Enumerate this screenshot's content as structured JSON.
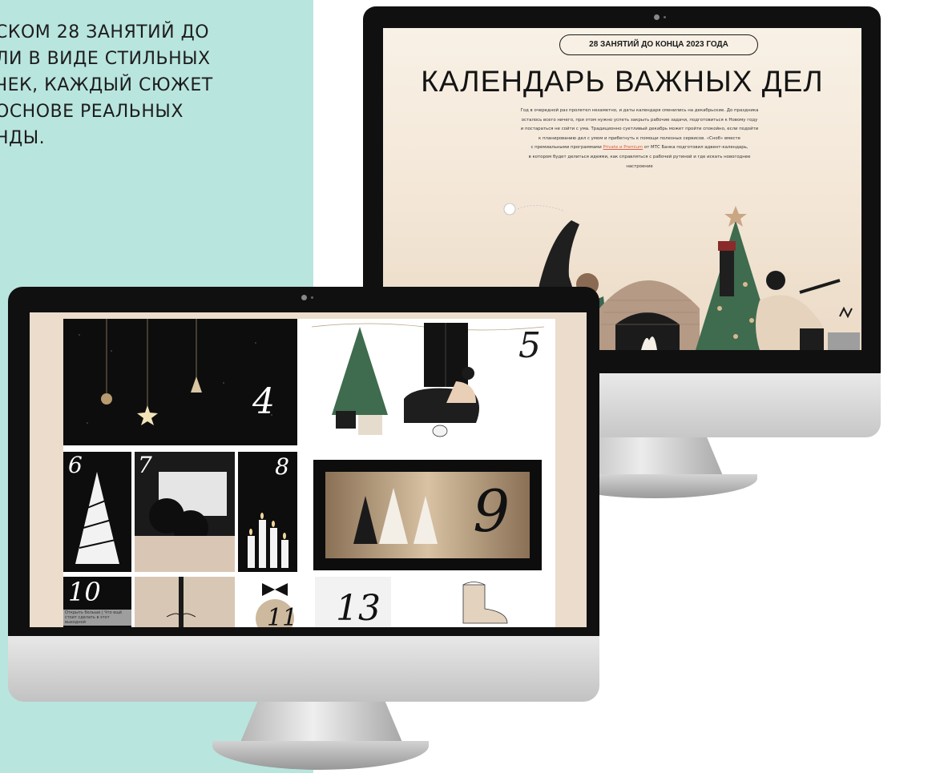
{
  "promo": {
    "lines": [
      "СКОМ 28 ЗАНЯТИЙ ДО",
      "ЛИ В ВИДЕ СТИЛЬНЫХ",
      "ЧЕК, КАЖДЫЙ СЮЖЕТ",
      "ОСНОВЕ РЕАЛЬНЫХ",
      "НДЫ."
    ]
  },
  "back_screen": {
    "badge": "28 ЗАНЯТИЙ ДО КОНЦА 2023 ГОДА",
    "title": "КАЛЕНДАРЬ ВАЖНЫХ ДЕЛ",
    "intro_lines": [
      "Год в очередной раз пролетел незаметно, и даты календаря сменились на декабрьские. До праздника",
      "осталось всего ничего, при этом нужно успеть закрыть рабочие задачи, подготовиться к Новому году",
      "и постараться не сойти с ума. Традиционно суетливый декабрь может пройти спокойно, если подойти",
      "к планированию дел с умом и прибегнуть к помощи полезных сервисов. «Сноб» вместе"
    ],
    "intro_link_prefix": "с премиальными программами ",
    "intro_link": "Private и Premium",
    "intro_link_suffix": " от МТС Банка подготовил адвент-календарь,",
    "intro_tail": [
      "в котором будет делиться идеями, как справляться с рабочей рутиной и где искать новогоднее",
      "настроение"
    ]
  },
  "front_screen": {
    "cells": {
      "n4": "4",
      "n5": "5",
      "n6": "6",
      "n7": "7",
      "n8": "8",
      "n9": "9",
      "n10": "10",
      "n11": "11",
      "n13": "13"
    },
    "caption": "Открыть больше | Что ещё стоит сделать в этот выходной"
  },
  "colors": {
    "teal": "#b9e5df",
    "frame": "#101010",
    "back_bg": "#f3e6d6",
    "gold": "#b59a79",
    "tree_green": "#3f6b4e",
    "link": "#d6624b"
  }
}
